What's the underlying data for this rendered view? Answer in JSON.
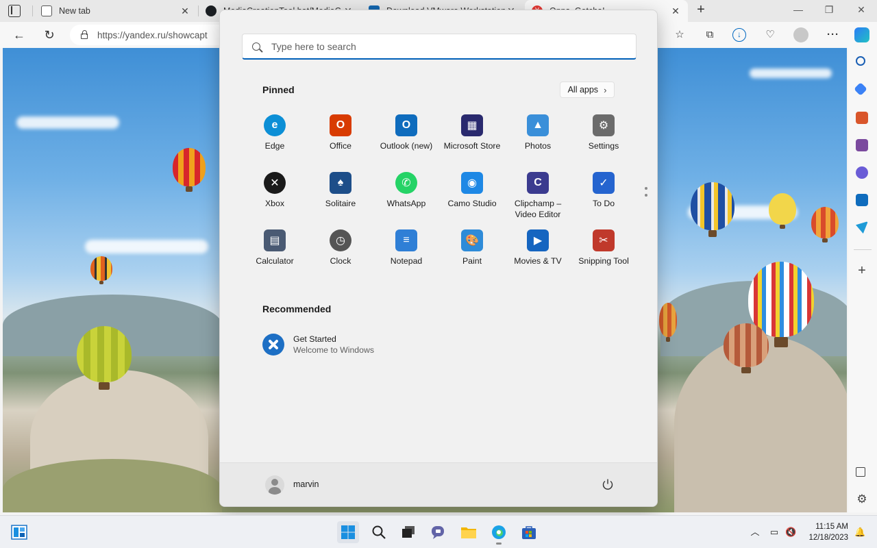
{
  "browser": {
    "tabs": [
      {
        "label": "New tab",
        "favicon": "new-tab-icon"
      },
      {
        "label": "MediaCreationTool.bat/MediaC",
        "favicon": "github-icon"
      },
      {
        "label": "Download VMware Workstation",
        "favicon": "vmware-icon"
      },
      {
        "label": "Opps, Gotcha!",
        "favicon": "yandex-icon"
      }
    ],
    "address": "https://yandex.ru/showcapt"
  },
  "start_menu": {
    "search_placeholder": "Type here to search",
    "pinned_title": "Pinned",
    "all_apps_label": "All apps",
    "pinned_apps": [
      {
        "label": "Edge",
        "icon": "edge-icon",
        "color": "#0c8fd6"
      },
      {
        "label": "Office",
        "icon": "office-icon",
        "color": "#d83b01"
      },
      {
        "label": "Outlook (new)",
        "icon": "outlook-icon",
        "color": "#0f6cbd"
      },
      {
        "label": "Microsoft Store",
        "icon": "store-icon",
        "color": "#2a2a6e"
      },
      {
        "label": "Photos",
        "icon": "photos-icon",
        "color": "#3a8fd9"
      },
      {
        "label": "Settings",
        "icon": "gear-icon",
        "color": "#6b6b6b"
      },
      {
        "label": "Xbox",
        "icon": "xbox-icon",
        "color": "#1a1a1a"
      },
      {
        "label": "Solitaire",
        "icon": "solitaire-icon",
        "color": "#1d4e89"
      },
      {
        "label": "WhatsApp",
        "icon": "whatsapp-icon",
        "color": "#25d366"
      },
      {
        "label": "Camo Studio",
        "icon": "camera-icon",
        "color": "#1e88e5"
      },
      {
        "label": "Clipchamp – Video Editor",
        "icon": "clipchamp-icon",
        "color": "#3b3b8f"
      },
      {
        "label": "To Do",
        "icon": "todo-icon",
        "color": "#2564cf"
      },
      {
        "label": "Calculator",
        "icon": "calculator-icon",
        "color": "#4a5a73"
      },
      {
        "label": "Clock",
        "icon": "clock-icon",
        "color": "#555555"
      },
      {
        "label": "Notepad",
        "icon": "notepad-icon",
        "color": "#2f7fd6"
      },
      {
        "label": "Paint",
        "icon": "paint-icon",
        "color": "#2e8bd8"
      },
      {
        "label": "Movies & TV",
        "icon": "movies-icon",
        "color": "#1565c0"
      },
      {
        "label": "Snipping Tool",
        "icon": "scissors-icon",
        "color": "#c0392b"
      }
    ],
    "recommended_title": "Recommended",
    "recommended": [
      {
        "title": "Get Started",
        "subtitle": "Welcome to Windows",
        "icon": "get-started-icon"
      }
    ],
    "user_name": "marvin"
  },
  "taskbar": {
    "time": "11:15 AM",
    "date": "12/18/2023"
  },
  "colors": {
    "accent": "#005fb8",
    "taskbar_bg": "#eef0f4",
    "menu_bg": "#f1f1f1"
  }
}
